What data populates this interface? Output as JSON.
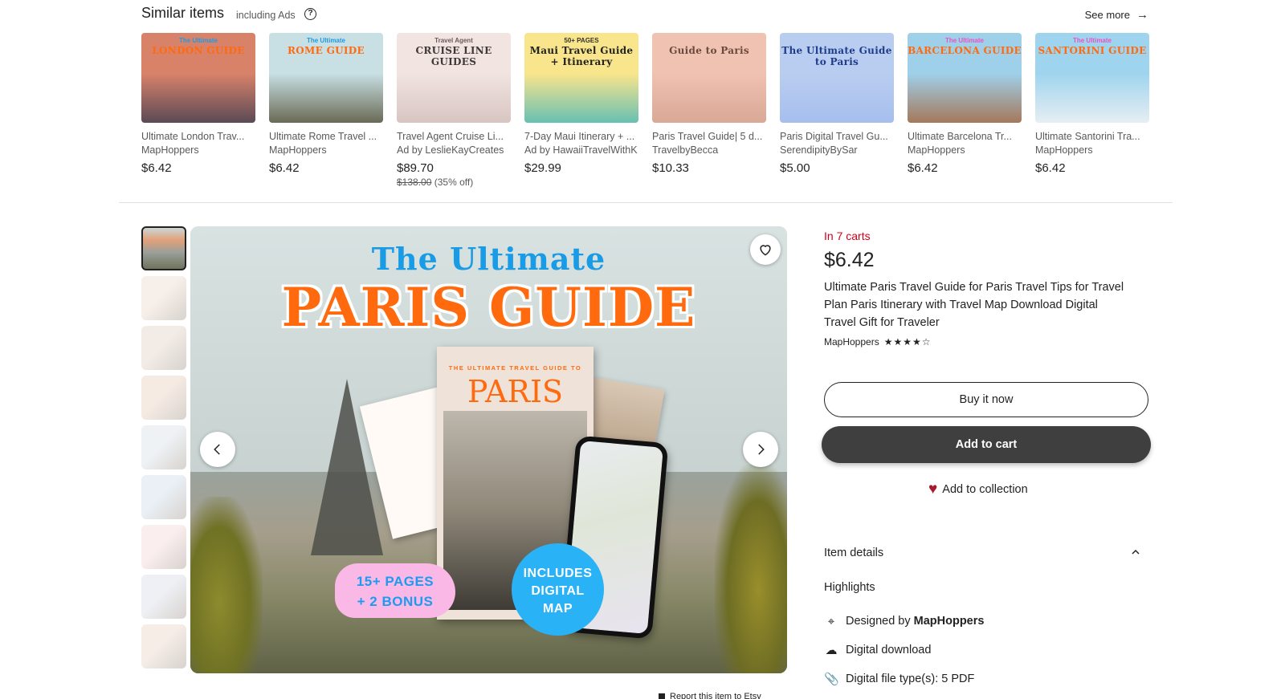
{
  "similar": {
    "title": "Similar items",
    "subtitle": "including Ads",
    "help_icon": "help-circle-icon",
    "see_more": "See more",
    "see_more_icon": "arrow-right-icon",
    "items": [
      {
        "name": "Ultimate London Trav...",
        "shop": "MapHoppers",
        "price": "$6.42",
        "thumb_top": "The Ultimate",
        "thumb_main": "LONDON GUIDE",
        "bg": "#d9826a",
        "bg2": "#5a4a55",
        "c1": "#1a9be6",
        "c2": "#ff6a0f"
      },
      {
        "name": "Ultimate Rome Travel ...",
        "shop": "MapHoppers",
        "price": "$6.42",
        "thumb_top": "The Ultimate",
        "thumb_main": "ROME GUIDE",
        "bg": "#c8e0e4",
        "bg2": "#6a6a55",
        "c1": "#1a9be6",
        "c2": "#ff6a0f"
      },
      {
        "name": "Travel Agent Cruise Li...",
        "shop": "Ad by LeslieKayCreates",
        "price": "$89.70",
        "original_price": "$138.00",
        "discount": "(35% off)",
        "thumb_top": "Travel Agent",
        "thumb_main": "CRUISE LINE GUIDES",
        "bg": "#f1e4e1",
        "bg2": "#d8c5c1",
        "c1": "#6b5a5a",
        "c2": "#3e3838"
      },
      {
        "name": "7-Day Maui Itinerary + ...",
        "shop": "Ad by HawaiiTravelWithK",
        "price": "$29.99",
        "thumb_top": "50+ PAGES",
        "thumb_main": "Maui Travel Guide + Itinerary",
        "bg": "#f9e58b",
        "bg2": "#67c0b2",
        "c1": "#333",
        "c2": "#222"
      },
      {
        "name": "Paris Travel Guide| 5 d...",
        "shop": "TravelbyBecca",
        "price": "$10.33",
        "thumb_top": "",
        "thumb_main": "Guide to Paris",
        "bg": "#f0c2b1",
        "bg2": "#d9a896",
        "c1": "#6a4a40",
        "c2": "#6a4a40"
      },
      {
        "name": "Paris Digital Travel Gu...",
        "shop": "SerendipityBySar",
        "price": "$5.00",
        "thumb_top": "",
        "thumb_main": "The Ultimate Guide to Paris",
        "bg": "#b9cdf0",
        "bg2": "#a6bfee",
        "c1": "#1f3c8c",
        "c2": "#1f3c8c"
      },
      {
        "name": "Ultimate Barcelona Tr...",
        "shop": "MapHoppers",
        "price": "$6.42",
        "thumb_top": "The Ultimate",
        "thumb_main": "BARCELONA GUIDE",
        "bg": "#9fd0ea",
        "bg2": "#a5785a",
        "c1": "#f04fc0",
        "c2": "#ff6a0f"
      },
      {
        "name": "Ultimate Santorini Tra...",
        "shop": "MapHoppers",
        "price": "$6.42",
        "thumb_top": "The Ultimate",
        "thumb_main": "SANTORINI GUIDE",
        "bg": "#9fd4ee",
        "bg2": "#e6eef3",
        "c1": "#f04fc0",
        "c2": "#ff6a0f"
      }
    ]
  },
  "gallery": {
    "thumb_count": 9,
    "thumb_colors": [
      "#7a8a86",
      "#f7efe9",
      "#f3ece6",
      "#f6ebe3",
      "#eef2f5",
      "#eaf0f6",
      "#faeeee",
      "#eef0f5",
      "#f5ede6"
    ],
    "main_image": {
      "title_line1": "The Ultimate",
      "title_line2": "PARIS GUIDE",
      "booklet_top": "THE ULTIMATE TRAVEL GUIDE TO",
      "booklet_title": "PARIS",
      "badge_pages_line1": "15+ PAGES",
      "badge_pages_line2": "+ 2 BONUS",
      "badge_map_line1": "INCLUDES",
      "badge_map_line2": "DIGITAL",
      "badge_map_line3": "MAP"
    },
    "favorite_icon": "heart-outline-icon",
    "prev_icon": "chevron-left-icon",
    "next_icon": "chevron-right-icon",
    "report_link": "Report this item to Etsy"
  },
  "product": {
    "carts_notice": "In 7 carts",
    "price": "$6.42",
    "title": "Ultimate Paris Travel Guide for Paris Travel Tips for Travel Plan Paris Itinerary with Travel Map Download Digital Travel Gift for Traveler",
    "seller": "MapHoppers",
    "rating": 4.5,
    "rating_max": 5,
    "buy_now": "Buy it now",
    "add_to_cart": "Add to cart",
    "add_to_collection": "Add to collection",
    "item_details": "Item details",
    "highlights_title": "Highlights",
    "highlights": [
      {
        "icon": "design-tool-icon",
        "prefix": "Designed by ",
        "bold": "MapHoppers"
      },
      {
        "icon": "cloud-download-icon",
        "prefix": "Digital download",
        "bold": ""
      },
      {
        "icon": "paperclip-icon",
        "prefix": "Digital file type(s): 5 PDF",
        "bold": ""
      }
    ]
  },
  "colors": {
    "accent_red": "#d20014",
    "cart_button": "#3f3f3f",
    "collection_heart": "#a61a2e"
  }
}
